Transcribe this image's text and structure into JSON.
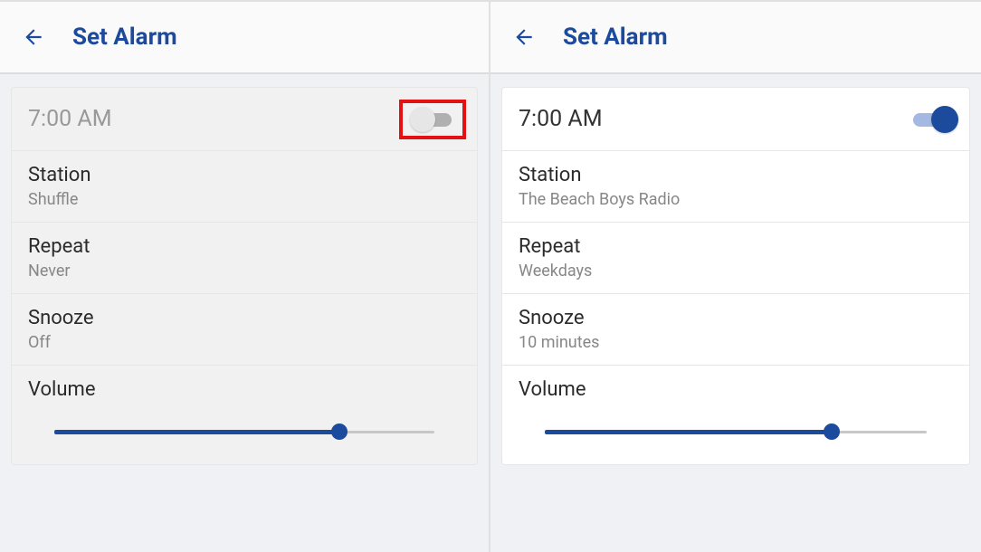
{
  "left": {
    "title": "Set Alarm",
    "time": "7:00 AM",
    "enabled": false,
    "highlighted": true,
    "station_label": "Station",
    "station_value": "Shuffle",
    "repeat_label": "Repeat",
    "repeat_value": "Never",
    "snooze_label": "Snooze",
    "snooze_value": "Off",
    "volume_label": "Volume",
    "volume_percent": 75
  },
  "right": {
    "title": "Set Alarm",
    "time": "7:00 AM",
    "enabled": true,
    "highlighted": false,
    "station_label": "Station",
    "station_value": "The Beach Boys Radio",
    "repeat_label": "Repeat",
    "repeat_value": "Weekdays",
    "snooze_label": "Snooze",
    "snooze_value": "10 minutes",
    "volume_label": "Volume",
    "volume_percent": 75
  },
  "colors": {
    "accent": "#1c4a9c",
    "highlight": "#e31111"
  }
}
